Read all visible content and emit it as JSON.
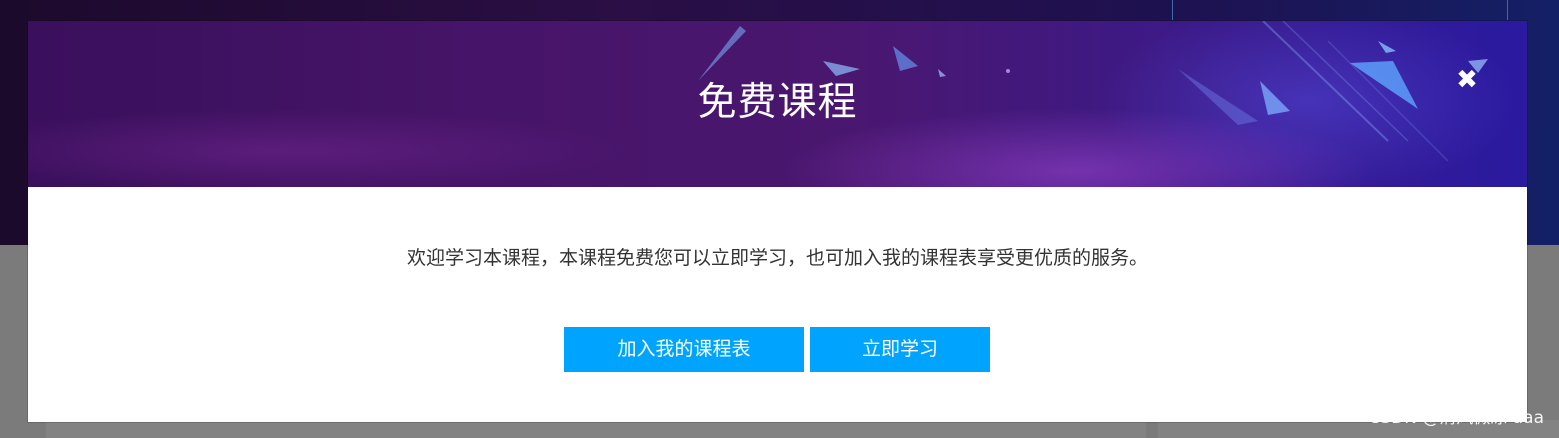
{
  "modal": {
    "title": "免费课程",
    "message": "欢迎学习本课程，本课程免费您可以立即学习，也可加入我的课程表享受更优质的服务。",
    "close_icon": "close-icon",
    "buttons": {
      "add_schedule": "加入我的课程表",
      "learn_now": "立即学习"
    }
  },
  "watermark": "CSDN @清风微凉 aaa",
  "colors": {
    "primary_button": "#00a4ff",
    "header_purple": "#461468",
    "header_blue": "#2a1aa0",
    "overlay_gray": "#7b7b7b",
    "message_text": "#333333"
  }
}
